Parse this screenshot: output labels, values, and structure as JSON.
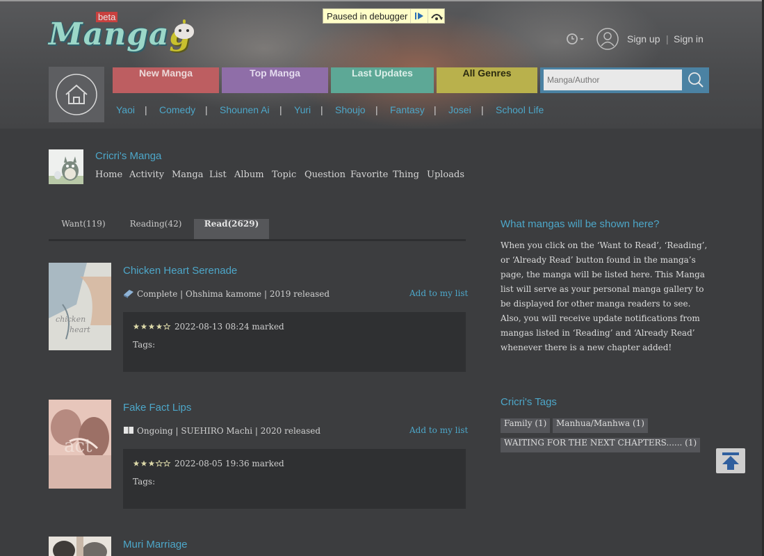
{
  "header": {
    "logo": {
      "beta": "beta",
      "word_main": "Manga",
      "word_g": "g"
    },
    "debugger": {
      "text": "Paused in debugger"
    },
    "user": {
      "signup": "Sign up",
      "separator": "|",
      "signin": "Sign in"
    },
    "nav": [
      "New Manga",
      "Top Manga",
      "Last Updates",
      "All Genres"
    ],
    "search": {
      "placeholder": "Manga/Author"
    },
    "genres": [
      "Yaoi",
      "Comedy",
      "Shounen Ai",
      "Yuri",
      "Shoujo",
      "Fantasy",
      "Josei",
      "School Life"
    ],
    "genre_separator": "|"
  },
  "profile": {
    "username": "Cricri's Manga",
    "nav": [
      "Home",
      "Activity",
      "Manga",
      "List",
      "Album",
      "Topic",
      "Question",
      "Favorite",
      "Thing",
      "Uploads"
    ]
  },
  "tabs": [
    {
      "label": "Want(119)",
      "active": false
    },
    {
      "label": "Reading(42)",
      "active": false
    },
    {
      "label": "Read(2629)",
      "active": true
    }
  ],
  "manga": [
    {
      "title": "Chicken Heart Serenade",
      "meta": "Complete | Ohshima kamome | 2019 released",
      "status_icon": "book-complete-icon",
      "add": "Add to my list",
      "rating": 4,
      "marked": "2022-08-13 08:24 marked",
      "tags_label": "Tags:",
      "cover_colors": [
        "#dcdcd6",
        "#a9b9c2",
        "#d6b49a"
      ]
    },
    {
      "title": "Fake Fact Lips",
      "meta": "Ongoing | SUEHIRO Machi | 2020 released",
      "status_icon": "book-ongoing-icon",
      "add": "Add to my list",
      "rating": 3,
      "marked": "2022-08-05 19:36 marked",
      "tags_label": "Tags:",
      "cover_colors": [
        "#d8b6ab",
        "#b68a80",
        "#f0d3c7"
      ]
    },
    {
      "title": "Muri Marriage",
      "cover_colors": [
        "#e8e3dc",
        "#6e6a66",
        "#c8b7a8"
      ]
    }
  ],
  "sidebar": {
    "info_title": "What mangas will be shown here?",
    "info_p1": "When you click on the ‘Want to Read’, ‘Reading’, or ‘Already Read’ button found in the manga’s page, the manga will be listed here. This Manga list will serve as your personal manga gallery to be displayed for other manga readers to see.",
    "info_p2": "Also, you will receive update notifications from mangas listed in ‘Reading’ and ‘Already Read’ whenever there is a new chapter added!",
    "tags_title": "Cricri's Tags",
    "tags": [
      "Family (1)",
      "Manhua/Manhwa (1)",
      "WAITING FOR THE NEXT CHAPTERS...... (1)"
    ]
  },
  "colors": {
    "link": "#4da7c9",
    "new_manga": "#bd5e61",
    "top_manga": "#8f6ea8",
    "last_updates": "#5da896",
    "all_genres": "#b9b14c",
    "search": "#4b82a3",
    "star": "#dcd8a8"
  }
}
